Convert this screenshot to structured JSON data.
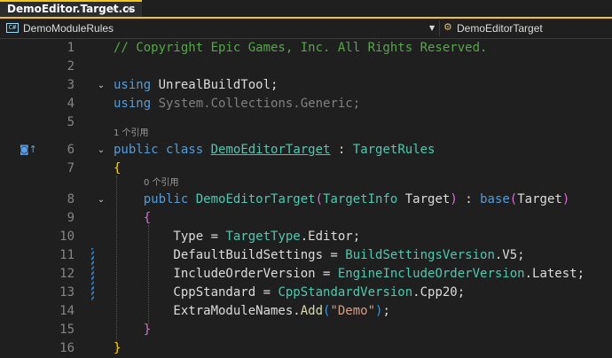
{
  "tab": {
    "title": "DemoEditor.Target.cs",
    "pin_icon": "pin-icon",
    "close_icon": "close-icon"
  },
  "navbar": {
    "left_icon": "csharp-project-icon",
    "left_label": "DemoModuleRules",
    "right_icon": "class-icon",
    "right_label": "DemoEditorTarget"
  },
  "codelens": {
    "class_refs": "1 个引用",
    "ctor_refs": "0 个引用"
  },
  "lines": [
    {
      "num": "1",
      "segments": [
        {
          "t": "// Copyright Epic Games, Inc. All Rights Reserved.",
          "c": "cm"
        }
      ]
    },
    {
      "num": "2",
      "segments": []
    },
    {
      "num": "3",
      "segments": [
        {
          "t": "using",
          "c": "kw"
        },
        {
          "t": " UnrealBuildTool;",
          "c": ""
        }
      ]
    },
    {
      "num": "4",
      "segments": [
        {
          "t": "using",
          "c": "kw"
        },
        {
          "t": " System.Collections.Generic;",
          "c": "gl"
        }
      ]
    },
    {
      "num": "5",
      "segments": []
    },
    {
      "num": "6",
      "segments": [
        {
          "t": "public",
          "c": "kw"
        },
        {
          "t": " ",
          "c": ""
        },
        {
          "t": "class",
          "c": "kw"
        },
        {
          "t": " ",
          "c": ""
        },
        {
          "t": "DemoEditorTarget",
          "c": "ty ul"
        },
        {
          "t": " : ",
          "c": ""
        },
        {
          "t": "TargetRules",
          "c": "ty"
        }
      ]
    },
    {
      "num": "7",
      "segments": [
        {
          "t": "{",
          "c": "bk1"
        }
      ]
    },
    {
      "num": "8",
      "segments": [
        {
          "t": "    ",
          "c": ""
        },
        {
          "t": "public",
          "c": "kw"
        },
        {
          "t": " ",
          "c": ""
        },
        {
          "t": "DemoEditorTarget",
          "c": "ty"
        },
        {
          "t": "(",
          "c": "bk2"
        },
        {
          "t": "TargetInfo",
          "c": "ty"
        },
        {
          "t": " Target",
          "c": ""
        },
        {
          "t": ")",
          "c": "bk2"
        },
        {
          "t": " : ",
          "c": ""
        },
        {
          "t": "base",
          "c": "kw"
        },
        {
          "t": "(",
          "c": "bk2"
        },
        {
          "t": "Target",
          "c": ""
        },
        {
          "t": ")",
          "c": "bk2"
        }
      ]
    },
    {
      "num": "9",
      "segments": [
        {
          "t": "    ",
          "c": ""
        },
        {
          "t": "{",
          "c": "bk2"
        }
      ]
    },
    {
      "num": "10",
      "segments": [
        {
          "t": "        Type = ",
          "c": ""
        },
        {
          "t": "TargetType",
          "c": "ty"
        },
        {
          "t": ".Editor;",
          "c": ""
        }
      ]
    },
    {
      "num": "11",
      "segments": [
        {
          "t": "        DefaultBuildSettings = ",
          "c": ""
        },
        {
          "t": "BuildSettingsVersion",
          "c": "ty"
        },
        {
          "t": ".V5;",
          "c": ""
        }
      ]
    },
    {
      "num": "12",
      "segments": [
        {
          "t": "        IncludeOrderVersion = ",
          "c": ""
        },
        {
          "t": "EngineIncludeOrderVersion",
          "c": "ty"
        },
        {
          "t": ".Latest;",
          "c": ""
        }
      ]
    },
    {
      "num": "13",
      "segments": [
        {
          "t": "        CppStandard = ",
          "c": ""
        },
        {
          "t": "CppStandardVersion",
          "c": "ty"
        },
        {
          "t": ".Cpp20;",
          "c": ""
        }
      ]
    },
    {
      "num": "14",
      "segments": [
        {
          "t": "        ExtraModuleNames.",
          "c": ""
        },
        {
          "t": "Add",
          "c": "mt"
        },
        {
          "t": "(",
          "c": "bk3"
        },
        {
          "t": "\"Demo\"",
          "c": "st"
        },
        {
          "t": ")",
          "c": "bk3"
        },
        {
          "t": ";",
          "c": ""
        }
      ]
    },
    {
      "num": "15",
      "segments": [
        {
          "t": "    ",
          "c": ""
        },
        {
          "t": "}",
          "c": "bk2"
        }
      ]
    },
    {
      "num": "16",
      "segments": [
        {
          "t": "}",
          "c": "bk1"
        }
      ]
    }
  ]
}
